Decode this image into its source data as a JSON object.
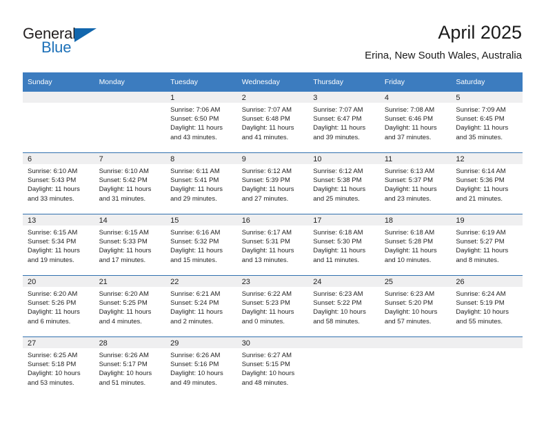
{
  "brand": {
    "name_part1": "General",
    "name_part2": "Blue",
    "triangle_color": "#1266ad",
    "blue_color": "#1c70b8"
  },
  "header": {
    "title": "April 2025",
    "subtitle": "Erina, New South Wales, Australia",
    "header_bg": "#3c7cbf",
    "daynum_band_bg": "#efeff0",
    "row_divider": "#2f6fae"
  },
  "weekday_headers": [
    "Sunday",
    "Monday",
    "Tuesday",
    "Wednesday",
    "Thursday",
    "Friday",
    "Saturday"
  ],
  "weeks": [
    [
      {
        "day": "",
        "l1": "",
        "l2": "",
        "l3": "",
        "l4": ""
      },
      {
        "day": "",
        "l1": "",
        "l2": "",
        "l3": "",
        "l4": ""
      },
      {
        "day": "1",
        "l1": "Sunrise: 7:06 AM",
        "l2": "Sunset: 6:50 PM",
        "l3": "Daylight: 11 hours",
        "l4": "and 43 minutes."
      },
      {
        "day": "2",
        "l1": "Sunrise: 7:07 AM",
        "l2": "Sunset: 6:48 PM",
        "l3": "Daylight: 11 hours",
        "l4": "and 41 minutes."
      },
      {
        "day": "3",
        "l1": "Sunrise: 7:07 AM",
        "l2": "Sunset: 6:47 PM",
        "l3": "Daylight: 11 hours",
        "l4": "and 39 minutes."
      },
      {
        "day": "4",
        "l1": "Sunrise: 7:08 AM",
        "l2": "Sunset: 6:46 PM",
        "l3": "Daylight: 11 hours",
        "l4": "and 37 minutes."
      },
      {
        "day": "5",
        "l1": "Sunrise: 7:09 AM",
        "l2": "Sunset: 6:45 PM",
        "l3": "Daylight: 11 hours",
        "l4": "and 35 minutes."
      }
    ],
    [
      {
        "day": "6",
        "l1": "Sunrise: 6:10 AM",
        "l2": "Sunset: 5:43 PM",
        "l3": "Daylight: 11 hours",
        "l4": "and 33 minutes."
      },
      {
        "day": "7",
        "l1": "Sunrise: 6:10 AM",
        "l2": "Sunset: 5:42 PM",
        "l3": "Daylight: 11 hours",
        "l4": "and 31 minutes."
      },
      {
        "day": "8",
        "l1": "Sunrise: 6:11 AM",
        "l2": "Sunset: 5:41 PM",
        "l3": "Daylight: 11 hours",
        "l4": "and 29 minutes."
      },
      {
        "day": "9",
        "l1": "Sunrise: 6:12 AM",
        "l2": "Sunset: 5:39 PM",
        "l3": "Daylight: 11 hours",
        "l4": "and 27 minutes."
      },
      {
        "day": "10",
        "l1": "Sunrise: 6:12 AM",
        "l2": "Sunset: 5:38 PM",
        "l3": "Daylight: 11 hours",
        "l4": "and 25 minutes."
      },
      {
        "day": "11",
        "l1": "Sunrise: 6:13 AM",
        "l2": "Sunset: 5:37 PM",
        "l3": "Daylight: 11 hours",
        "l4": "and 23 minutes."
      },
      {
        "day": "12",
        "l1": "Sunrise: 6:14 AM",
        "l2": "Sunset: 5:36 PM",
        "l3": "Daylight: 11 hours",
        "l4": "and 21 minutes."
      }
    ],
    [
      {
        "day": "13",
        "l1": "Sunrise: 6:15 AM",
        "l2": "Sunset: 5:34 PM",
        "l3": "Daylight: 11 hours",
        "l4": "and 19 minutes."
      },
      {
        "day": "14",
        "l1": "Sunrise: 6:15 AM",
        "l2": "Sunset: 5:33 PM",
        "l3": "Daylight: 11 hours",
        "l4": "and 17 minutes."
      },
      {
        "day": "15",
        "l1": "Sunrise: 6:16 AM",
        "l2": "Sunset: 5:32 PM",
        "l3": "Daylight: 11 hours",
        "l4": "and 15 minutes."
      },
      {
        "day": "16",
        "l1": "Sunrise: 6:17 AM",
        "l2": "Sunset: 5:31 PM",
        "l3": "Daylight: 11 hours",
        "l4": "and 13 minutes."
      },
      {
        "day": "17",
        "l1": "Sunrise: 6:18 AM",
        "l2": "Sunset: 5:30 PM",
        "l3": "Daylight: 11 hours",
        "l4": "and 11 minutes."
      },
      {
        "day": "18",
        "l1": "Sunrise: 6:18 AM",
        "l2": "Sunset: 5:28 PM",
        "l3": "Daylight: 11 hours",
        "l4": "and 10 minutes."
      },
      {
        "day": "19",
        "l1": "Sunrise: 6:19 AM",
        "l2": "Sunset: 5:27 PM",
        "l3": "Daylight: 11 hours",
        "l4": "and 8 minutes."
      }
    ],
    [
      {
        "day": "20",
        "l1": "Sunrise: 6:20 AM",
        "l2": "Sunset: 5:26 PM",
        "l3": "Daylight: 11 hours",
        "l4": "and 6 minutes."
      },
      {
        "day": "21",
        "l1": "Sunrise: 6:20 AM",
        "l2": "Sunset: 5:25 PM",
        "l3": "Daylight: 11 hours",
        "l4": "and 4 minutes."
      },
      {
        "day": "22",
        "l1": "Sunrise: 6:21 AM",
        "l2": "Sunset: 5:24 PM",
        "l3": "Daylight: 11 hours",
        "l4": "and 2 minutes."
      },
      {
        "day": "23",
        "l1": "Sunrise: 6:22 AM",
        "l2": "Sunset: 5:23 PM",
        "l3": "Daylight: 11 hours",
        "l4": "and 0 minutes."
      },
      {
        "day": "24",
        "l1": "Sunrise: 6:23 AM",
        "l2": "Sunset: 5:22 PM",
        "l3": "Daylight: 10 hours",
        "l4": "and 58 minutes."
      },
      {
        "day": "25",
        "l1": "Sunrise: 6:23 AM",
        "l2": "Sunset: 5:20 PM",
        "l3": "Daylight: 10 hours",
        "l4": "and 57 minutes."
      },
      {
        "day": "26",
        "l1": "Sunrise: 6:24 AM",
        "l2": "Sunset: 5:19 PM",
        "l3": "Daylight: 10 hours",
        "l4": "and 55 minutes."
      }
    ],
    [
      {
        "day": "27",
        "l1": "Sunrise: 6:25 AM",
        "l2": "Sunset: 5:18 PM",
        "l3": "Daylight: 10 hours",
        "l4": "and 53 minutes."
      },
      {
        "day": "28",
        "l1": "Sunrise: 6:26 AM",
        "l2": "Sunset: 5:17 PM",
        "l3": "Daylight: 10 hours",
        "l4": "and 51 minutes."
      },
      {
        "day": "29",
        "l1": "Sunrise: 6:26 AM",
        "l2": "Sunset: 5:16 PM",
        "l3": "Daylight: 10 hours",
        "l4": "and 49 minutes."
      },
      {
        "day": "30",
        "l1": "Sunrise: 6:27 AM",
        "l2": "Sunset: 5:15 PM",
        "l3": "Daylight: 10 hours",
        "l4": "and 48 minutes."
      },
      {
        "day": "",
        "l1": "",
        "l2": "",
        "l3": "",
        "l4": ""
      },
      {
        "day": "",
        "l1": "",
        "l2": "",
        "l3": "",
        "l4": ""
      },
      {
        "day": "",
        "l1": "",
        "l2": "",
        "l3": "",
        "l4": ""
      }
    ]
  ]
}
